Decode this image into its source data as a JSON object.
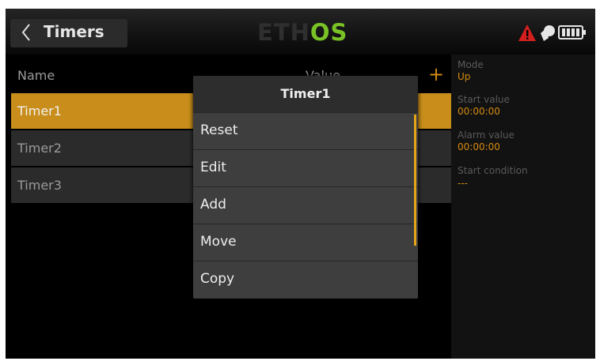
{
  "header": {
    "title": "Timers",
    "logo_main": "ETH",
    "logo_accent": "OS",
    "icons": [
      "back-chevron-icon",
      "warning-icon",
      "rf-icon",
      "battery-icon"
    ],
    "accent_color": "#79c226"
  },
  "list": {
    "columns": {
      "name": "Name",
      "value": "Value"
    },
    "add_label": "+",
    "rows": [
      {
        "label": "Timer1",
        "selected": true
      },
      {
        "label": "Timer2",
        "selected": false
      },
      {
        "label": "Timer3",
        "selected": false
      }
    ],
    "selected_color": "#c88d1a"
  },
  "info": {
    "mode_label": "Mode",
    "mode_value": "Up",
    "start_label": "Start value",
    "start_value": "00:00:00",
    "alarm_label": "Alarm value",
    "alarm_value": "00:00:00",
    "cond_label": "Start condition",
    "cond_value": "---",
    "value_color": "#d48a10"
  },
  "dialog": {
    "title": "Timer1",
    "items": [
      "Reset",
      "Edit",
      "Add",
      "Move",
      "Copy"
    ],
    "scrollbar_color": "#e8a418"
  }
}
